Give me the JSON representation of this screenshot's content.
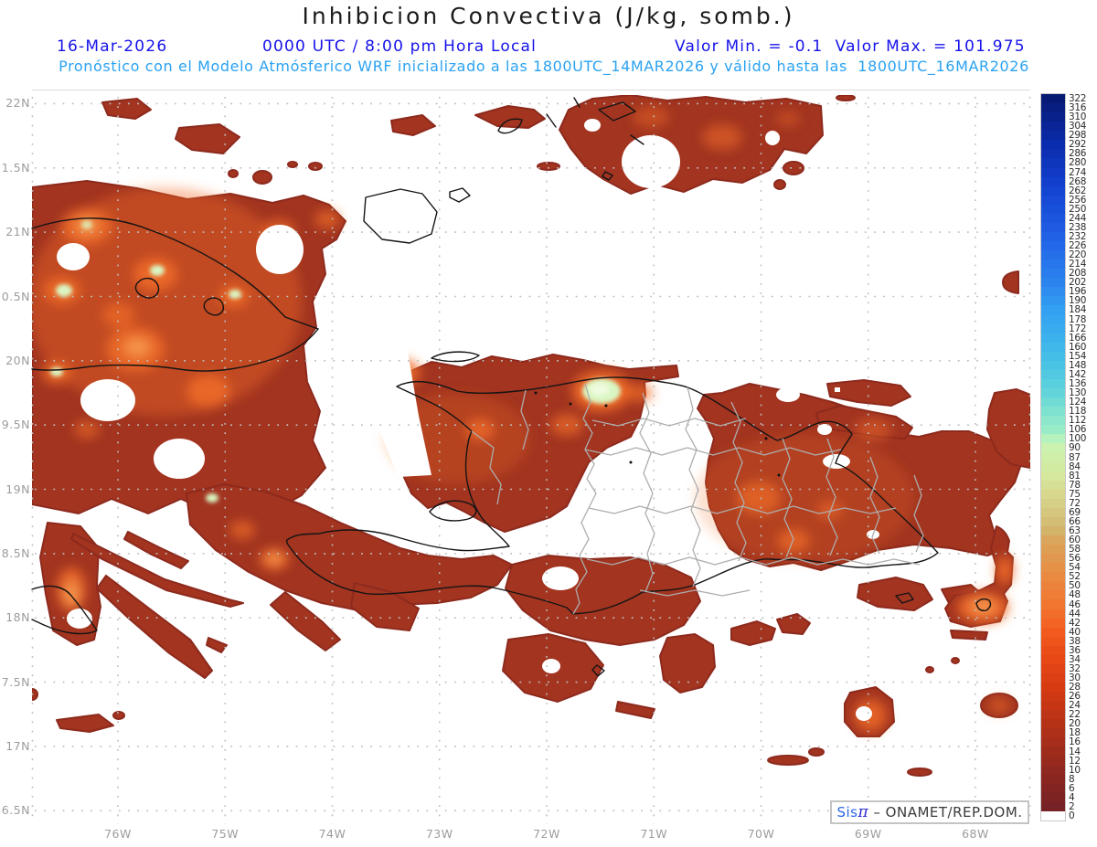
{
  "header": {
    "title": "Inhibicion Convectiva (J/kg, somb.)",
    "date": "16-Mar-2026",
    "time": "0000 UTC / 8:00 pm Hora Local",
    "min_max": "Valor Min. = -0.1  Valor Max. = 101.975",
    "forecast_line": "Pronóstico con el Modelo Atmósferico WRF inicializado a las 1800UTC_14MAR2026 y válido hasta las  1800UTC_16MAR2026"
  },
  "attribution": {
    "sis": "Sis",
    "pi": "π",
    "rest": " – ONAMET/REP.DOM."
  },
  "axes": {
    "lat_labels": [
      "22N",
      "1.5N",
      "21N",
      "0.5N",
      "20N",
      "9.5N",
      "19N",
      "8.5N",
      "18N",
      "7.5N",
      "17N",
      "6.5N"
    ],
    "lon_labels": [
      "76W",
      "75W",
      "74W",
      "73W",
      "72W",
      "71W",
      "70W",
      "69W",
      "68W"
    ]
  },
  "colorbar": {
    "labels": [
      322,
      316,
      310,
      304,
      298,
      292,
      286,
      280,
      274,
      268,
      262,
      256,
      250,
      244,
      238,
      232,
      226,
      220,
      214,
      208,
      202,
      196,
      190,
      184,
      178,
      172,
      166,
      160,
      154,
      148,
      142,
      136,
      130,
      124,
      118,
      112,
      106,
      100,
      90,
      87,
      84,
      81,
      78,
      75,
      72,
      69,
      66,
      63,
      60,
      58,
      56,
      54,
      52,
      50,
      48,
      46,
      44,
      42,
      40,
      38,
      36,
      34,
      32,
      30,
      28,
      26,
      24,
      22,
      20,
      18,
      16,
      14,
      12,
      10,
      8,
      6,
      4,
      2,
      0
    ],
    "stops": [
      [
        322,
        "#071A74"
      ],
      [
        292,
        "#0A2CAE"
      ],
      [
        262,
        "#1444D2"
      ],
      [
        232,
        "#2161E6"
      ],
      [
        202,
        "#2B84EE"
      ],
      [
        184,
        "#33A0F2"
      ],
      [
        166,
        "#3BB2EC"
      ],
      [
        148,
        "#4AC4E4"
      ],
      [
        130,
        "#62D4DA"
      ],
      [
        118,
        "#7EE2D0"
      ],
      [
        106,
        "#99ECC8"
      ],
      [
        100,
        "#B6F2BE"
      ],
      [
        90,
        "#CBF2AE"
      ],
      [
        81,
        "#D6E89E"
      ],
      [
        75,
        "#D7D88E"
      ],
      [
        69,
        "#D5C87E"
      ],
      [
        63,
        "#D3B26A"
      ],
      [
        58,
        "#DE9E54"
      ],
      [
        52,
        "#EA8A42"
      ],
      [
        46,
        "#F1762F"
      ],
      [
        40,
        "#F25A1E"
      ],
      [
        34,
        "#E84716"
      ],
      [
        28,
        "#D63B12"
      ],
      [
        22,
        "#BE3416"
      ],
      [
        16,
        "#A62E1A"
      ],
      [
        10,
        "#8F281E"
      ],
      [
        6,
        "#832422"
      ],
      [
        2,
        "#772226"
      ],
      [
        0,
        "#FFFFFF"
      ]
    ]
  },
  "colors": {
    "title": "#1c1c1c",
    "line2": "#1612EA",
    "line3": "#2AA2F2",
    "axis_label": "#9c9c9c",
    "grid": "#bfbfbf",
    "shade_base": "#A23420",
    "shade_orange": "#F06C28",
    "shade_green": "#D9F6C2",
    "coastline": "#141414",
    "admin_border": "#adadad"
  }
}
